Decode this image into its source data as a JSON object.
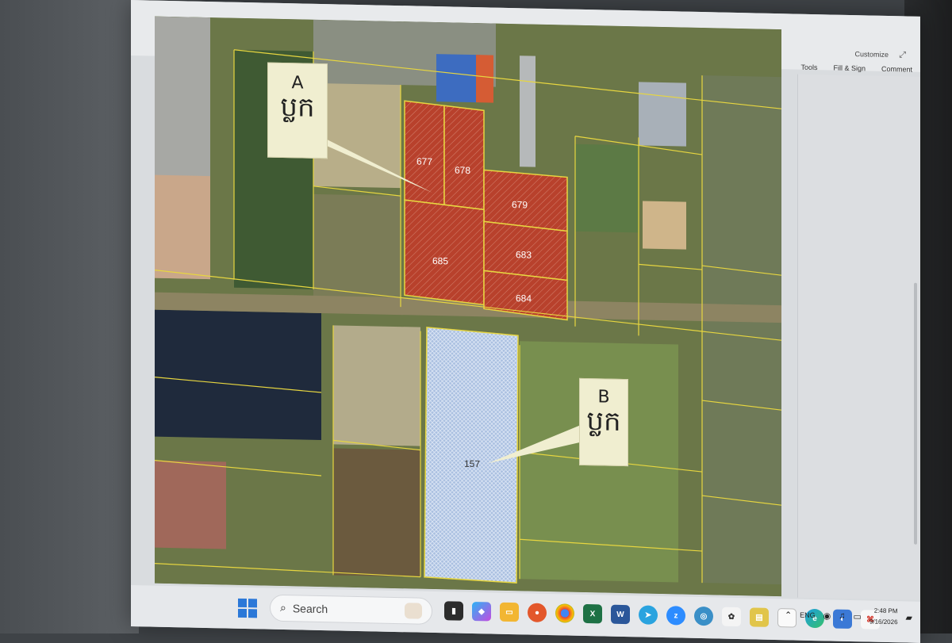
{
  "app": {
    "customize_label": "Customize",
    "tabs": [
      "Tools",
      "Fill & Sign",
      "Comment"
    ]
  },
  "map": {
    "callout_a": {
      "letter": "A",
      "text": "ប្លក"
    },
    "callout_b": {
      "letter": "B",
      "text": "ប្លក"
    },
    "parcels_red": [
      "677",
      "678",
      "679",
      "685",
      "683",
      "684"
    ],
    "parcel_blue": "157",
    "colors": {
      "parcel_red": "#b8412c",
      "parcel_blue": "#a9bfe0",
      "boundary": "#e7d640",
      "callout_bg": "#f0eed0"
    }
  },
  "taskbar": {
    "search_placeholder": "Search",
    "language": "ENG",
    "time": "2:48 PM",
    "date": "9/16/2026",
    "icons": [
      "windows-start-icon",
      "search-icon",
      "file-explorer-icon",
      "copilot-icon",
      "folder-icon",
      "firefox-icon",
      "chrome-icon",
      "excel-icon",
      "word-icon",
      "telegram-icon",
      "zoom-icon",
      "maps-icon",
      "settings-icon",
      "files-icon",
      "blank-doc-icon",
      "edge-icon",
      "app-icon",
      "acrobat-icon"
    ]
  }
}
